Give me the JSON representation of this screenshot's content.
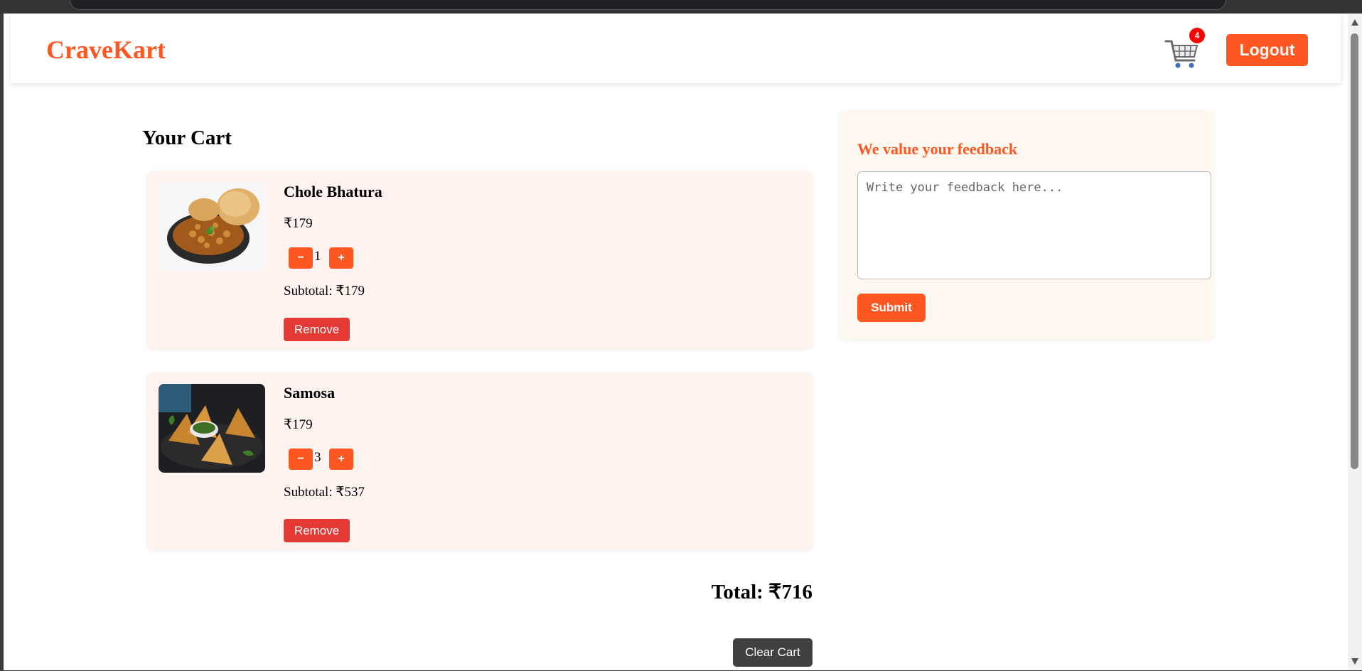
{
  "brand": {
    "name": "CraveKart",
    "color": "#ff5722"
  },
  "header": {
    "cart_count": "4",
    "logout_label": "Logout"
  },
  "cart": {
    "title": "Your Cart",
    "items": [
      {
        "name": "Chole Bhatura",
        "price": "₹179",
        "quantity": "1",
        "subtotal": "Subtotal: ₹179",
        "remove_label": "Remove",
        "decrement_label": "−",
        "increment_label": "+"
      },
      {
        "name": "Samosa",
        "price": "₹179",
        "quantity": "3",
        "subtotal": "Subtotal: ₹537",
        "remove_label": "Remove",
        "decrement_label": "−",
        "increment_label": "+"
      }
    ],
    "total": "Total: ₹716",
    "clear_label": "Clear Cart"
  },
  "feedback": {
    "title": "We value your feedback",
    "placeholder": "Write your feedback here...",
    "value": "",
    "submit_label": "Submit"
  },
  "colors": {
    "accent": "#ff5722",
    "remove": "#e53935",
    "badge": "#ff0000",
    "clear": "#404040"
  }
}
